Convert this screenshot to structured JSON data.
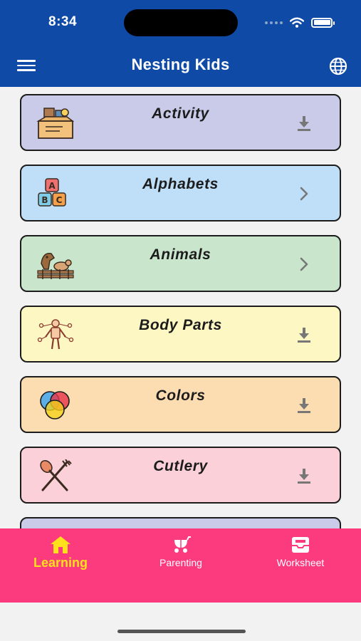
{
  "status_bar": {
    "time": "8:34"
  },
  "header": {
    "title": "Nesting Kids"
  },
  "categories": [
    {
      "label": "Activity",
      "bg": "#c9cbe9",
      "icon": "activity-box-icon",
      "action": "download-icon"
    },
    {
      "label": "Alphabets",
      "bg": "#bfdff9",
      "icon": "abc-blocks-icon",
      "action": "chevron-right-icon"
    },
    {
      "label": "Animals",
      "bg": "#c9e6cc",
      "icon": "animals-icon",
      "action": "chevron-right-icon"
    },
    {
      "label": "Body Parts",
      "bg": "#fdf7c4",
      "icon": "body-parts-icon",
      "action": "download-icon"
    },
    {
      "label": "Colors",
      "bg": "#fcdcb1",
      "icon": "color-circles-icon",
      "action": "download-icon"
    },
    {
      "label": "Cutlery",
      "bg": "#fcd0d8",
      "icon": "cutlery-icon",
      "action": "download-icon"
    },
    {
      "label": "",
      "bg": "#c9cbe9"
    }
  ],
  "tabbar": {
    "tabs": [
      {
        "label": "Learning",
        "icon": "home-icon",
        "active": true
      },
      {
        "label": "Parenting",
        "icon": "stroller-icon",
        "active": false
      },
      {
        "label": "Worksheet",
        "icon": "worksheet-icon",
        "active": false
      }
    ]
  },
  "colors": {
    "header_bg": "#0e4aa6",
    "tabbar_bg": "#fc3b7e",
    "active_tab": "#ffe01b"
  }
}
